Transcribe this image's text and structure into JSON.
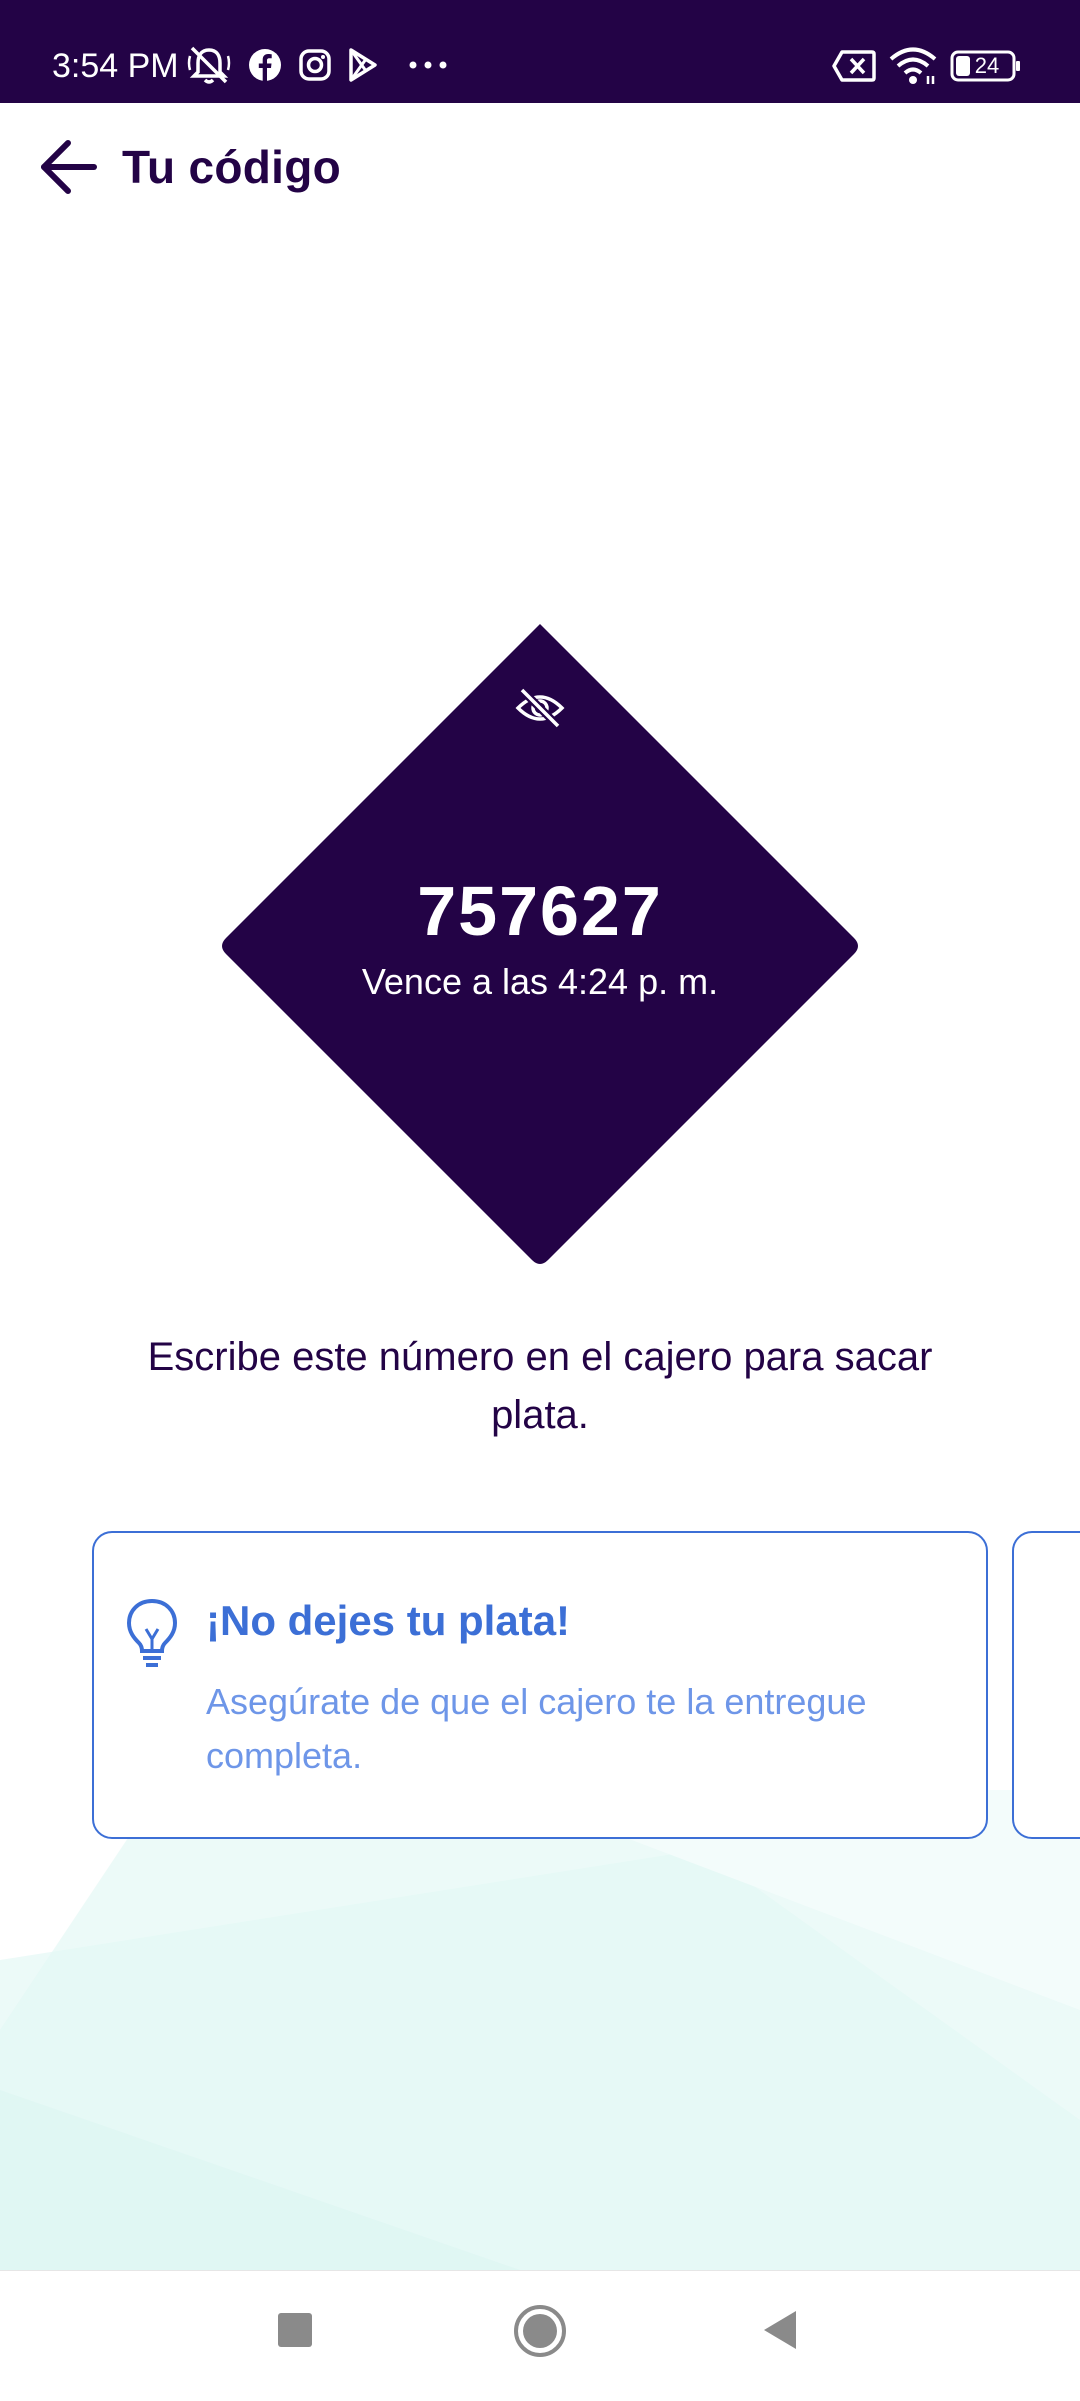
{
  "status_bar": {
    "time": "3:54 PM",
    "battery": "24",
    "icons": [
      "mute-icon",
      "facebook-icon",
      "instagram-icon",
      "play-store-icon",
      "more-icon",
      "no-sim-icon",
      "wifi-icon",
      "battery-icon"
    ]
  },
  "header": {
    "back_icon": "arrow-left-icon",
    "title": "Tu código"
  },
  "code_card": {
    "visibility_icon": "eye-off-icon",
    "code": "757627",
    "expiry": "Vence a las 4:24 p. m."
  },
  "instruction": "Escribe este número en el cajero para sacar plata.",
  "tips": [
    {
      "icon": "lightbulb-icon",
      "title": "¡No dejes tu plata!",
      "body": "Asegúrate de que el cajero te la entregue completa."
    }
  ],
  "nav_bar": {
    "buttons": [
      "recents-square-icon",
      "home-circle-icon",
      "back-triangle-icon"
    ]
  },
  "colors": {
    "brand_dark": "#230346",
    "accent_blue": "#3c6fd6",
    "tip_text": "#6e96e8",
    "background_tint": "#e2f7f4"
  }
}
